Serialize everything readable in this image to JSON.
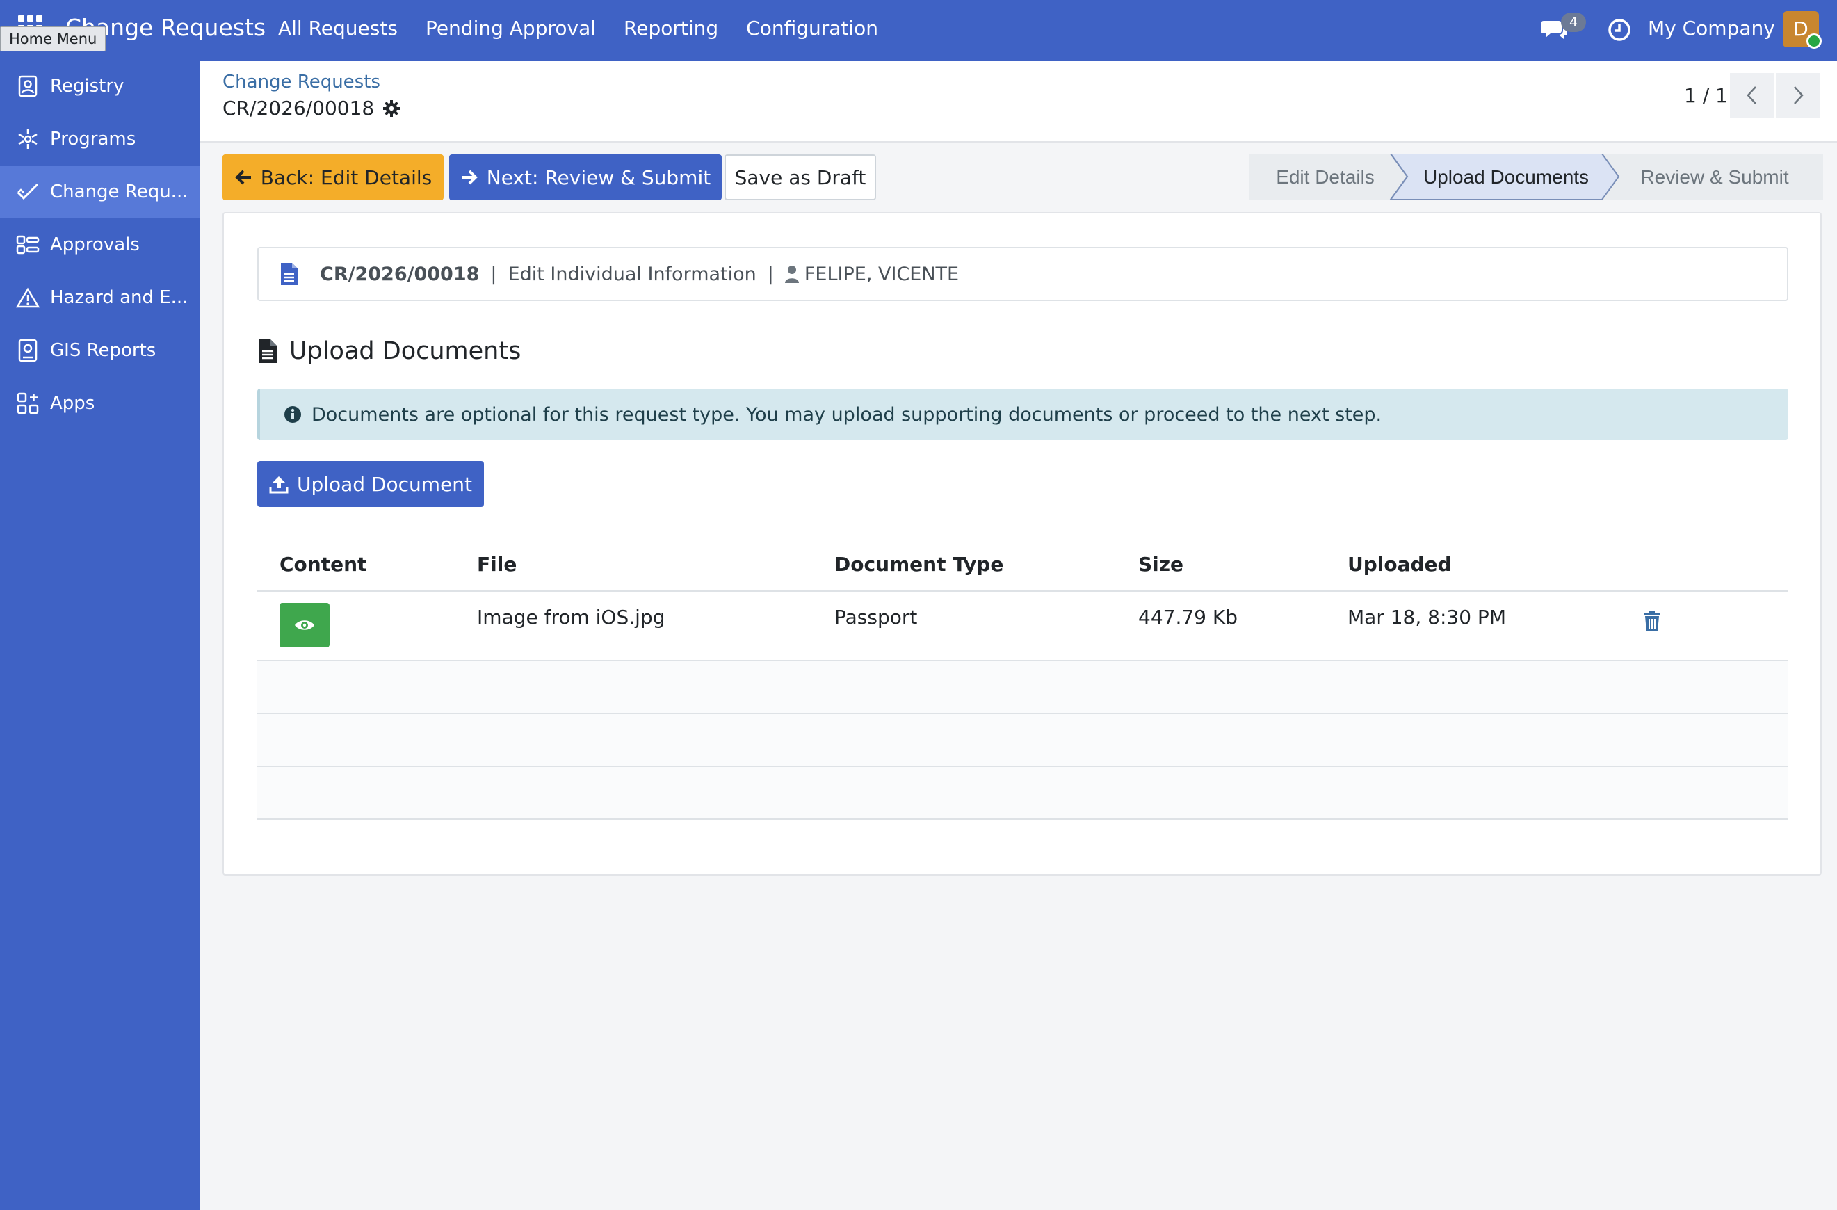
{
  "topbar": {
    "brand": "Change Requests",
    "home_tooltip": "Home Menu",
    "menu": [
      "All Requests",
      "Pending Approval",
      "Reporting",
      "Configuration"
    ],
    "chat_count": "4",
    "company": "My Company",
    "avatar_letter": "D",
    "accent": "#3f62c5"
  },
  "sidebar": {
    "items": [
      {
        "label": "Registry",
        "icon": "registry-icon"
      },
      {
        "label": "Programs",
        "icon": "programs-icon"
      },
      {
        "label": "Change Requ...",
        "icon": "change-requests-icon",
        "active": true
      },
      {
        "label": "Approvals",
        "icon": "approvals-icon"
      },
      {
        "label": "Hazard and E...",
        "icon": "hazard-icon"
      },
      {
        "label": "GIS Reports",
        "icon": "gis-reports-icon"
      },
      {
        "label": "Apps",
        "icon": "apps-icon"
      }
    ]
  },
  "control": {
    "breadcrumb_parent": "Change Requests",
    "record": "CR/2026/00018",
    "pager": "1 / 1"
  },
  "actions": {
    "back": "Back: Edit Details",
    "next": "Next: Review & Submit",
    "draft": "Save as Draft"
  },
  "steps": [
    "Edit Details",
    "Upload Documents",
    "Review & Submit"
  ],
  "active_step": "Upload Documents",
  "info_bar": {
    "ref": "CR/2026/00018",
    "type": "Edit Individual Information",
    "person": "FELIPE, VICENTE",
    "sep": "|"
  },
  "section": {
    "title": "Upload Documents",
    "alert": "Documents are optional for this request type. You may upload supporting documents or proceed to the next step.",
    "upload_button": "Upload Document"
  },
  "table": {
    "headers": [
      "Content",
      "File",
      "Document Type",
      "Size",
      "Uploaded"
    ],
    "rows": [
      {
        "file": "Image from iOS.jpg",
        "doc_type": "Passport",
        "size": "447.79 Kb",
        "uploaded": "Mar 18, 8:30 PM"
      }
    ]
  }
}
